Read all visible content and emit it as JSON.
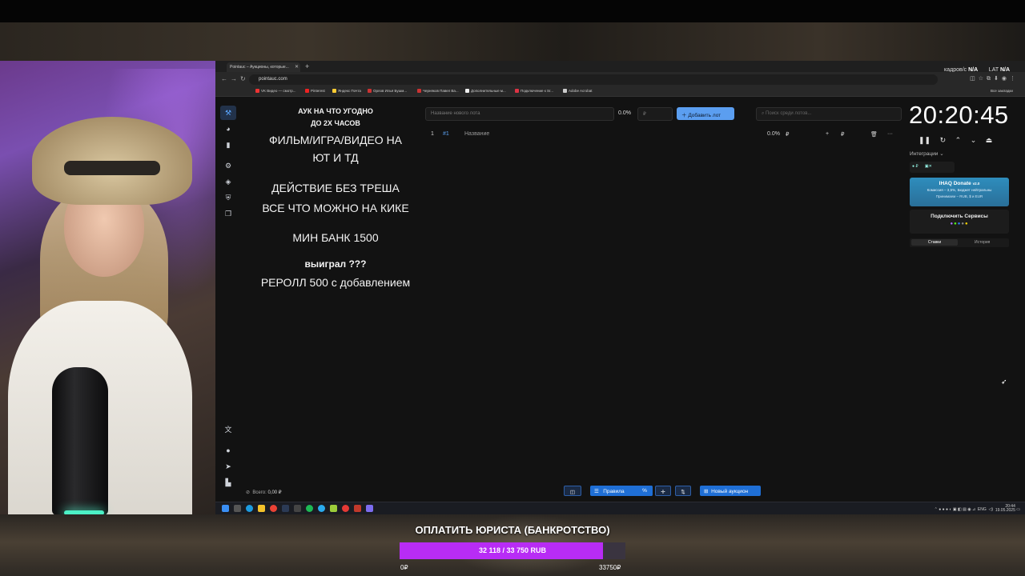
{
  "browser": {
    "tab_title": "Pointauc – Аукционы, которые...",
    "url": "pointauc.com",
    "overlay": {
      "fps_label": "кадров/с",
      "fps_value": "N/A",
      "lat_label": "LAT",
      "lat_value": "N/A"
    },
    "bookmarks": [
      "VK Видео — смотр...",
      "Pinterest",
      "Яндекс Почта",
      "Орлов Илья Бушм...",
      "Черняков Павел Ва...",
      "Дополнительные м...",
      "Подключение к Sr...",
      "Adobe Acrobat"
    ],
    "all_bookmarks": "Все закладки"
  },
  "rules": {
    "line1": "АУК НА ЧТО УГОДНО",
    "line2": "ДО 2Х ЧАСОВ",
    "line3": "ФИЛЬМ/ИГРА/ВИДЕО НА",
    "line4": "ЮТ И ТД",
    "line5": "ДЕЙСТВИЕ БЕЗ ТРЕША",
    "line6": "ВСЕ ЧТО МОЖНО НА КИКЕ",
    "line7": "МИН БАНК 1500",
    "line8": "выиграл ???",
    "line9": "РЕРОЛЛ 500 с добавлением"
  },
  "lot_form": {
    "name_placeholder": "Название нового лота",
    "percent": "0.0%",
    "currency": "₽",
    "add_label": "Добавить лот",
    "search_placeholder": "Поиск среди лотов..."
  },
  "lot_row": {
    "index": "1",
    "id": "#1",
    "name_placeholder": "Название",
    "percent": "0.0%",
    "currency": "₽"
  },
  "timer": {
    "value": "20:20:45"
  },
  "integrations": {
    "title": "Интеграции",
    "donate_title": "IHAQ Donate",
    "donate_version": "v2.0",
    "donate_fee": "Комиссия – 3,5%, Бюджет нейтральны",
    "donate_accepts": "Принимаем – RUB, $ и EUR",
    "connect_label": "Подключить Сервисы",
    "tab_stakes": "Ставки",
    "tab_history": "История"
  },
  "footer": {
    "total_label": "Всего:",
    "total_value": "0,00 ₽",
    "rules_label": "Правила",
    "new_auction_label": "Новый аукцион"
  },
  "taskbar": {
    "lang": "ENG",
    "time": "20:44",
    "date": "19.05.2025"
  },
  "goal": {
    "title": "ОПЛАТИТЬ ЮРИСТА (БАНКРОТСТВО)",
    "progress_text": "32 118 / 33 750 RUB",
    "current": 32118,
    "target": 33750,
    "min_label": "0₽",
    "max_label": "33750₽",
    "fill_color": "#b82cf5"
  }
}
